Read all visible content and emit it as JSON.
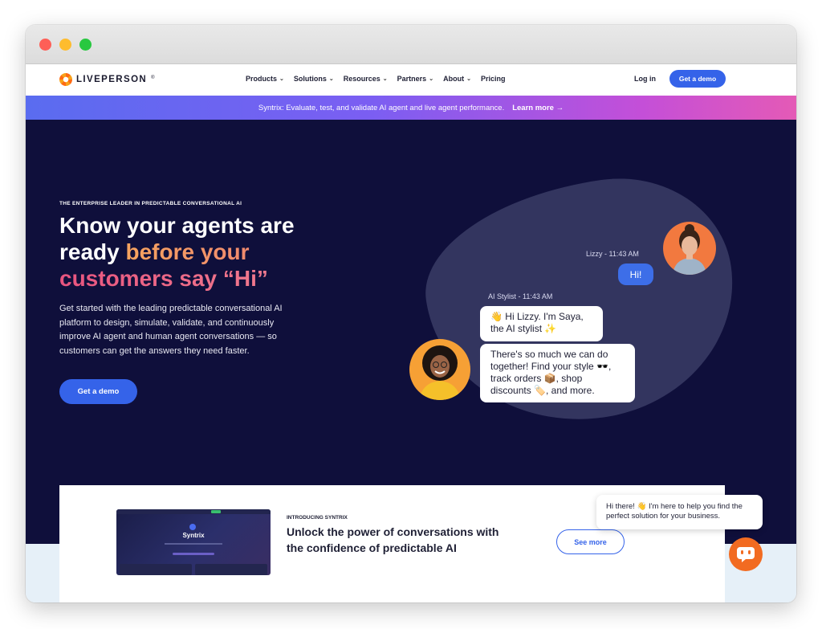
{
  "nav": {
    "brand": "LIVEPERSON",
    "brand_mark": "®",
    "items": [
      {
        "label": "Products",
        "icon": "chevron-down-icon"
      },
      {
        "label": "Solutions",
        "icon": "chevron-down-icon"
      },
      {
        "label": "Resources",
        "icon": "chevron-down-icon"
      },
      {
        "label": "Partners",
        "icon": "chevron-down-icon"
      },
      {
        "label": "About",
        "icon": "chevron-down-icon"
      },
      {
        "label": "Pricing"
      }
    ],
    "login": "Log in",
    "demo": "Get a demo"
  },
  "banner": {
    "text": "Syntrix: Evaluate, test, and validate AI agent and live agent performance.",
    "link": "Learn more →"
  },
  "hero": {
    "eyebrow": "THE ENTERPRISE LEADER IN PREDICTABLE CONVERSATIONAL AI",
    "headline_1": "Know your agents are ready ",
    "headline_2": "before your",
    "headline_3": "customers say “Hi”",
    "description": "Get started with the leading predictable conversational AI platform to design, simulate, validate, and continuously improve AI agent and human agent conversations — so customers can get the answers they need faster.",
    "cta": "Get a demo"
  },
  "chat": {
    "user_meta": "Lizzy - 11:43 AM",
    "user_message": "Hi!",
    "bot_meta": "AI Stylist - 11:43 AM",
    "bot_message_1": "👋 Hi Lizzy. I'm Saya, the AI stylist ✨",
    "bot_message_2": "There's so much we can do together! Find your style 🕶️, track orders 📦, shop discounts 🏷️, and more."
  },
  "syntrix_card": {
    "screenshot_title": "Syntrix",
    "eyebrow": "INTRODUCING SYNTRIX",
    "title": "Unlock the power of conversations with the confidence of predictable AI",
    "button": "See more"
  },
  "chat_widget": {
    "message": "Hi there! 👋 I'm here to help you find the perfect solution for your business."
  },
  "colors": {
    "hero_bg": "#0f0f3b",
    "accent_blue": "#3563e9",
    "brand_orange": "#f26b21"
  }
}
